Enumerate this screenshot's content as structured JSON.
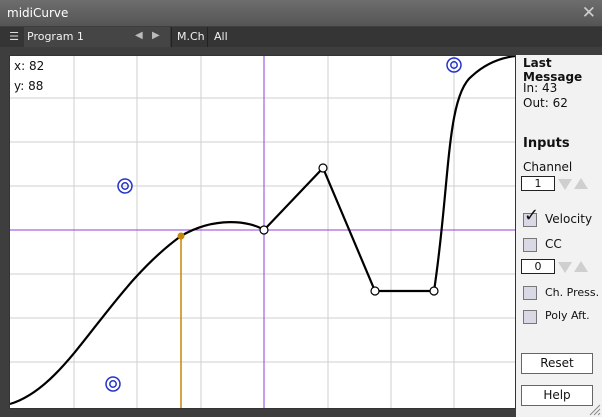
{
  "window": {
    "title": "midiCurve"
  },
  "toolbar": {
    "program": "Program 1",
    "mch_label": "M.Ch",
    "all_label": "All"
  },
  "plot": {
    "x_readout": "x: 82",
    "y_readout": "y: 88"
  },
  "panel": {
    "last_message_title": "Last Message",
    "in_text": "In: 43",
    "out_text": "Out: 62",
    "inputs_title": "Inputs",
    "channel_label": "Channel",
    "channel_value": "1",
    "velocity_label": "Velocity",
    "velocity_checked": true,
    "cc_label": "CC",
    "cc_checked": false,
    "cc_value": "0",
    "ch_press_label": "Ch. Press.",
    "ch_press_checked": false,
    "poly_aft_label": "Poly Aft.",
    "poly_aft_checked": false,
    "reset_label": "Reset",
    "help_label": "Help"
  },
  "colors": {
    "crosshair": "#8f3fd9",
    "marker": "#c8860a",
    "handle_ring": "#2433c9"
  }
}
